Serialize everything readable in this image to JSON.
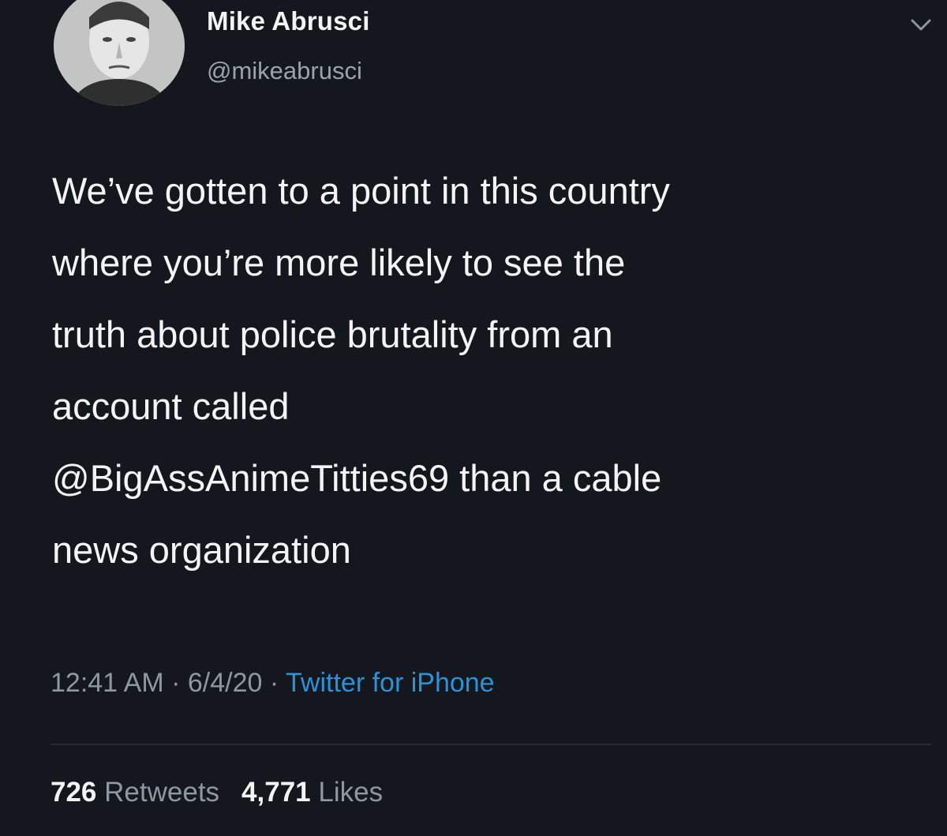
{
  "author": {
    "display_name": "Mike Abrusci",
    "handle": "@mikeabrusci"
  },
  "tweet": {
    "text": "We’ve gotten to a point in this country\nwhere you’re more likely to see the\ntruth about police brutality from an\naccount called\n@BigAssAnimeTitties69 than a cable\nnews organization"
  },
  "meta": {
    "time": "12:41 AM",
    "separator1": " · ",
    "date": "6/4/20",
    "separator2": " · ",
    "source": "Twitter for iPhone"
  },
  "stats": {
    "retweets_count": "726",
    "retweets_label": "Retweets",
    "likes_count": "4,771",
    "likes_label": "Likes"
  },
  "colors": {
    "background": "#14171e",
    "text": "#f4f4f4",
    "muted": "#8f98a2",
    "link": "#2a93d8"
  },
  "icons": {
    "menu": "chevron-down-icon"
  }
}
